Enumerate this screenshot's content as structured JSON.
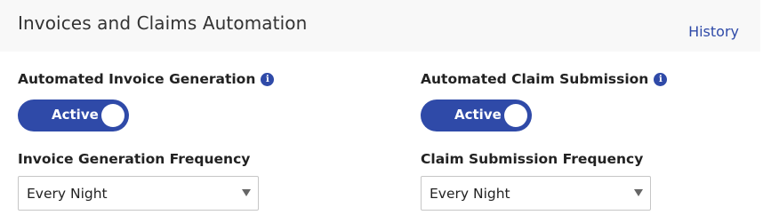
{
  "header": {
    "title": "Invoices and Claims Automation",
    "history_link": "History"
  },
  "invoice": {
    "label": "Automated Invoice Generation",
    "info_icon": "info-icon",
    "toggle_state": "Active",
    "frequency_label": "Invoice Generation Frequency",
    "frequency_value": "Every Night"
  },
  "claim": {
    "label": "Automated Claim Submission",
    "info_icon": "info-icon",
    "toggle_state": "Active",
    "frequency_label": "Claim Submission Frequency",
    "frequency_value": "Every Night"
  },
  "colors": {
    "accent": "#2f4aa8",
    "header_bg": "#f8f8f8",
    "border": "#c6c6c6"
  }
}
